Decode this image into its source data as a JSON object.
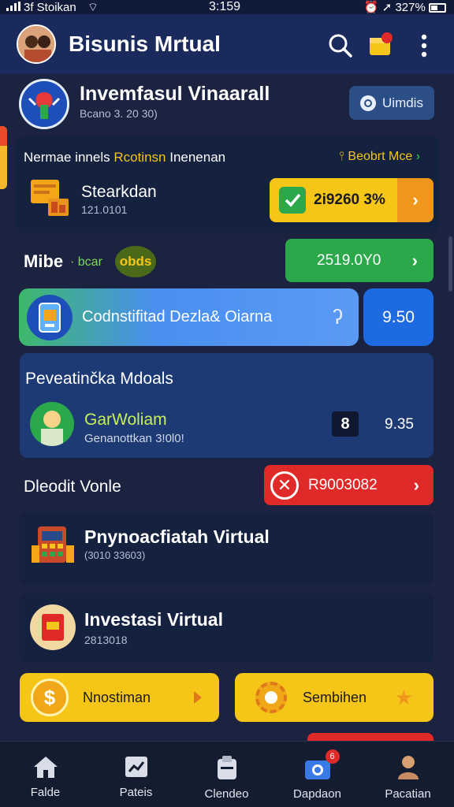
{
  "status_bar": {
    "carrier": "3f Stoikan",
    "time": "3:159",
    "battery": "327%"
  },
  "header": {
    "title": "Bisunis Mrtual",
    "icons": [
      "avatar",
      "search-icon",
      "notification-box-icon",
      "more-vertical-icon"
    ]
  },
  "profile_card": {
    "title": "Invemfasul Vinaarall",
    "subtitle": "Bcano 3. 20 30)",
    "action_label": "Uimdis"
  },
  "featured": {
    "heading": "Nermae innels",
    "heading_highlight": "Rcotinsn",
    "heading_tail": "Inenenan",
    "link": "Beobrt Mce",
    "item_title": "Stearkdan",
    "item_sub": "121.0101",
    "value_pill": "2i9260 3%"
  },
  "mibe_row": {
    "label": "Mibe",
    "sub_label": "· bcar",
    "badge": "obds",
    "value": "2519.0Y0"
  },
  "search_bar": {
    "text": "Codnstifitad Dezla& Oiarna",
    "side_value": "9.50"
  },
  "prevention_card": {
    "heading": "Peveatinčka Mdoals",
    "item_title": "GarWoliam",
    "item_sub": "Genanottkan 3!0l0!",
    "badge_number": "8",
    "value": "9.35"
  },
  "dleodit_row": {
    "label": "Dleodit Vonle",
    "value": "R9003082"
  },
  "list_cards": [
    {
      "title": "Pnynoacfiatah Virtual",
      "sub": "(3010 33603)"
    },
    {
      "title": "Investasi Virtual",
      "sub": "2813018"
    }
  ],
  "action_buttons": [
    {
      "label": "Nnostiman"
    },
    {
      "label": "Sembihen"
    }
  ],
  "bottom_nav": [
    {
      "label": "Falde",
      "icon": "home-icon"
    },
    {
      "label": "Pateis",
      "icon": "chart-card-icon"
    },
    {
      "label": "Clendeo",
      "icon": "document-icon"
    },
    {
      "label": "Dapdaon",
      "icon": "camera-icon",
      "badge": "6"
    },
    {
      "label": "Pacatian",
      "icon": "person-icon"
    }
  ],
  "colors": {
    "background": "#1b2340",
    "header": "#1a2a5c",
    "green": "#2aa84a",
    "yellow": "#f5c518",
    "red": "#e02a2a",
    "blue": "#4a8ff0"
  }
}
